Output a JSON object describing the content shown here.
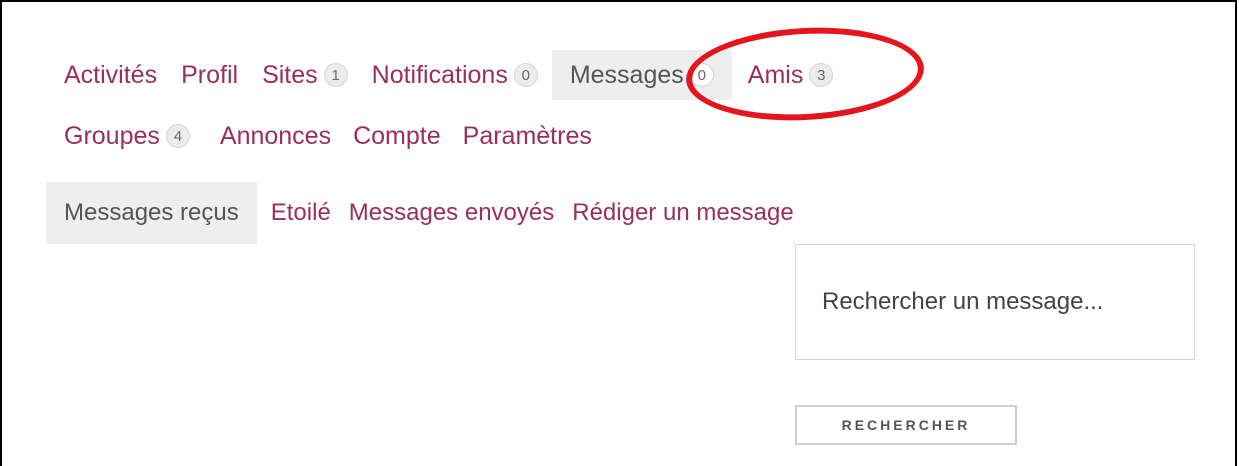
{
  "nav": {
    "row1": [
      {
        "label": "Activités"
      },
      {
        "label": "Profil"
      },
      {
        "label": "Sites",
        "count": "1"
      },
      {
        "label": "Notifications",
        "count": "0"
      },
      {
        "label": "Messages",
        "count": "0",
        "active": true
      },
      {
        "label": "Amis",
        "count": "3"
      }
    ],
    "row2": [
      {
        "label": "Groupes",
        "count": "4"
      },
      {
        "label": "Annonces"
      },
      {
        "label": "Compte"
      },
      {
        "label": "Paramètres"
      }
    ]
  },
  "subnav": {
    "items": [
      {
        "label": "Messages reçus",
        "active": true
      },
      {
        "label": "Etoilé"
      },
      {
        "label": "Messages envoyés"
      },
      {
        "label": "Rédiger un message"
      }
    ]
  },
  "search": {
    "placeholder": "Rechercher un message...",
    "button_label": "RECHERCHER"
  },
  "colors": {
    "link": "#9a2f5c",
    "active_bg": "#eeeeee",
    "highlight": "#e4151c"
  }
}
